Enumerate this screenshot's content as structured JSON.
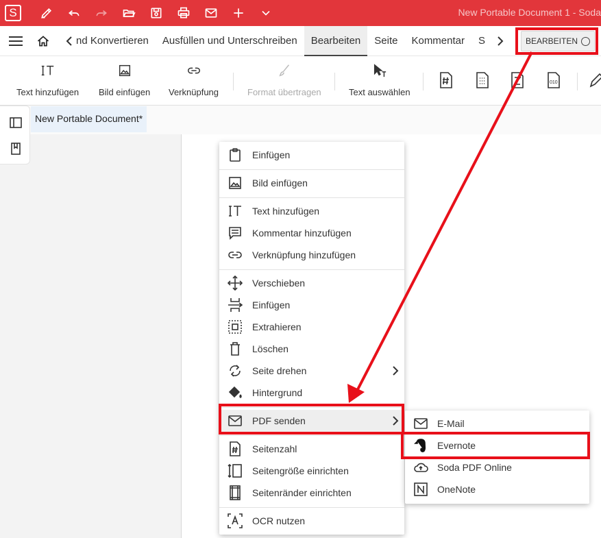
{
  "app": {
    "logo_letter": "S",
    "window_title": "New Portable Document 1  -  Soda"
  },
  "titlebar_icons": [
    "pen-icon",
    "undo-icon",
    "redo-icon",
    "open-folder-icon",
    "save-icon",
    "print-icon",
    "mail-icon",
    "plus-icon",
    "chevron-down-icon"
  ],
  "tabs": {
    "items": [
      {
        "label": "nd Konvertieren"
      },
      {
        "label": "Ausfüllen und Unterschreiben"
      },
      {
        "label": "Bearbeiten",
        "active": true
      },
      {
        "label": "Seite"
      },
      {
        "label": "Kommentar"
      },
      {
        "label": "S"
      }
    ],
    "edit_toggle_label": "BEARBEITEN"
  },
  "ribbon": {
    "buttons": [
      {
        "label": "Text hinzufügen",
        "icon": "text-add-icon"
      },
      {
        "label": "Bild einfügen",
        "icon": "image-icon"
      },
      {
        "label": "Verknüpfung",
        "icon": "link-icon"
      },
      {
        "label": "Format übertragen",
        "icon": "brush-icon",
        "disabled": true
      },
      {
        "label": "Text auswählen",
        "icon": "cursor-text-icon"
      }
    ],
    "more_icons": [
      "page-number-icon",
      "page-grid-icon",
      "page-z-icon",
      "page-binary-icon",
      "edit-icon"
    ]
  },
  "document_tab": {
    "title": "New Portable Document*"
  },
  "context_menu": {
    "items": [
      {
        "label": "Einfügen",
        "icon": "clipboard-icon"
      },
      {
        "label": "Bild einfügen",
        "icon": "image-icon"
      },
      {
        "label": "Text hinzufügen",
        "icon": "text-add-icon"
      },
      {
        "label": "Kommentar hinzufügen",
        "icon": "comment-icon"
      },
      {
        "label": "Verknüpfung hinzufügen",
        "icon": "link-icon"
      },
      {
        "label": "Verschieben",
        "icon": "move-icon"
      },
      {
        "label": "Einfügen",
        "icon": "insert-page-icon"
      },
      {
        "label": "Extrahieren",
        "icon": "extract-icon"
      },
      {
        "label": "Löschen",
        "icon": "trash-icon"
      },
      {
        "label": "Seite drehen",
        "icon": "rotate-icon",
        "submenu": true
      },
      {
        "label": "Hintergrund",
        "icon": "paint-bucket-icon"
      },
      {
        "label": "PDF senden",
        "icon": "mail-icon",
        "submenu": true,
        "highlighted": true
      },
      {
        "label": "Seitenzahl",
        "icon": "page-number-icon"
      },
      {
        "label": "Seitengröße einrichten",
        "icon": "page-size-icon"
      },
      {
        "label": "Seitenränder einrichten",
        "icon": "page-margins-icon"
      },
      {
        "label": "OCR nutzen",
        "icon": "ocr-icon"
      }
    ]
  },
  "send_submenu": {
    "items": [
      {
        "label": "E-Mail",
        "icon": "mail-icon"
      },
      {
        "label": "Evernote",
        "icon": "evernote-icon"
      },
      {
        "label": "Soda PDF Online",
        "icon": "cloud-icon"
      },
      {
        "label": "OneNote",
        "icon": "onenote-icon"
      }
    ]
  },
  "annotation": {
    "color": "#e8101a"
  },
  "colors": {
    "brand": "#e2363b"
  }
}
